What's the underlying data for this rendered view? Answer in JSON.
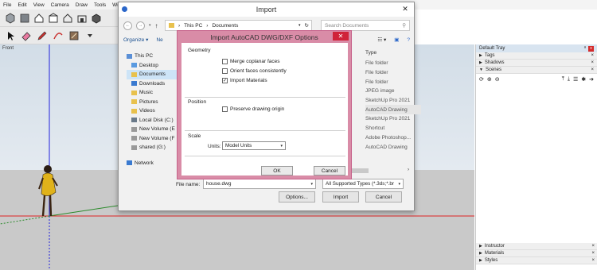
{
  "menubar": [
    "File",
    "Edit",
    "View",
    "Camera",
    "Draw",
    "Tools",
    "Wi"
  ],
  "viewport": {
    "label": "Front"
  },
  "tray": {
    "title": "Default Tray",
    "pin": "ᵃ",
    "close": "x",
    "panels_top": [
      {
        "label": "Tags",
        "expanded": false
      },
      {
        "label": "Shadows",
        "expanded": false
      },
      {
        "label": "Scenes",
        "expanded": true
      }
    ],
    "panels_bottom": [
      {
        "label": "Instructor"
      },
      {
        "label": "Materials"
      },
      {
        "label": "Styles"
      }
    ]
  },
  "import_dialog": {
    "title": "Import",
    "close": "✕",
    "address": [
      "This PC",
      "Documents"
    ],
    "search_placeholder": "Search Documents",
    "organize": "Organize ▾",
    "new_folder": "Ne",
    "nav_items": [
      {
        "label": "This PC",
        "icon": "pc-icon"
      },
      {
        "label": "Desktop",
        "icon": "folder-icon"
      },
      {
        "label": "Documents",
        "icon": "folder-icon",
        "selected": true
      },
      {
        "label": "Downloads",
        "icon": "folder-icon"
      },
      {
        "label": "Music",
        "icon": "folder-icon"
      },
      {
        "label": "Pictures",
        "icon": "folder-icon"
      },
      {
        "label": "Videos",
        "icon": "folder-icon"
      },
      {
        "label": "Local Disk (C:)",
        "icon": "disk-icon"
      },
      {
        "label": "New Volume (E",
        "icon": "drive-icon"
      },
      {
        "label": "New Volume (F",
        "icon": "drive-icon"
      },
      {
        "label": "shared (G:)",
        "icon": "drive-icon"
      }
    ],
    "network": "Network",
    "type_header": "Type",
    "types": [
      "File folder",
      "File folder",
      "File folder",
      "JPEG image",
      "SketchUp Pro 2021",
      "AutoCAD Drawing",
      "SketchUp Pro 2021",
      "Shortcut",
      "Adobe Photoshop...",
      "AutoCAD Drawing"
    ],
    "file_name_label": "File name:",
    "file_name_value": "house.dwg",
    "file_type_value": "All Supported Types (*.3ds;*.br",
    "options_button": "Options...",
    "import_button": "Import",
    "cancel_button": "Cancel"
  },
  "options_dialog": {
    "title": "Import AutoCAD DWG/DXF Options",
    "close": "✕",
    "geometry_label": "Geometry",
    "merge_coplanar": {
      "label": "Merge coplanar faces",
      "checked": false
    },
    "orient_faces": {
      "label": "Orient faces consistently",
      "checked": false
    },
    "import_materials": {
      "label": "Import Materials",
      "checked": true
    },
    "position_label": "Position",
    "preserve_origin": {
      "label": "Preserve drawing origin",
      "checked": false
    },
    "scale_label": "Scale",
    "units_label": "Units:",
    "units_value": "Model Units",
    "ok_button": "OK",
    "cancel_button": "Cancel"
  }
}
